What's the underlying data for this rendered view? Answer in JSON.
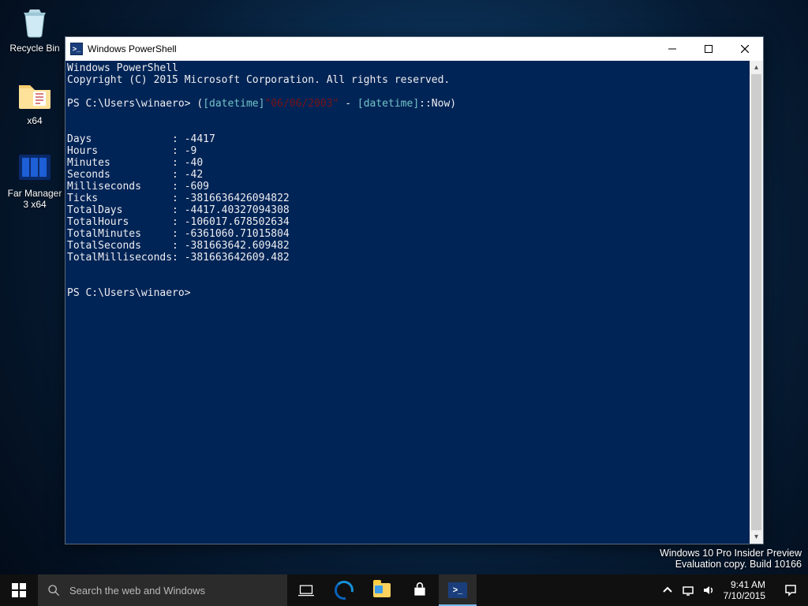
{
  "desktop": {
    "icons": [
      {
        "label": "Recycle Bin"
      },
      {
        "label": "x64"
      },
      {
        "label1": "Far Manager",
        "label2": "3 x64"
      }
    ]
  },
  "window": {
    "title": "Windows PowerShell",
    "console": {
      "header1": "Windows PowerShell",
      "header2": "Copyright (C) 2015 Microsoft Corporation. All rights reserved.",
      "prompt": "PS C:\\Users\\winaero> ",
      "cmd_open": "(",
      "cmd_type1": "[datetime]",
      "cmd_str": "\"06/06/2003\"",
      "cmd_mid": " - ",
      "cmd_type2": "[datetime]",
      "cmd_tail": "::Now)",
      "rows": [
        {
          "k": "Days",
          "v": "-4417"
        },
        {
          "k": "Hours",
          "v": "-9"
        },
        {
          "k": "Minutes",
          "v": "-40"
        },
        {
          "k": "Seconds",
          "v": "-42"
        },
        {
          "k": "Milliseconds",
          "v": "-609"
        },
        {
          "k": "Ticks",
          "v": "-3816636426094822"
        },
        {
          "k": "TotalDays",
          "v": "-4417.40327094308"
        },
        {
          "k": "TotalHours",
          "v": "-106017.678502634"
        },
        {
          "k": "TotalMinutes",
          "v": "-6361060.71015804"
        },
        {
          "k": "TotalSeconds",
          "v": "-381663642.609482"
        },
        {
          "k": "TotalMilliseconds",
          "v": "-381663642609.482"
        }
      ],
      "prompt2": "PS C:\\Users\\winaero> "
    }
  },
  "watermark": {
    "line1": "Windows 10 Pro Insider Preview",
    "line2": "Evaluation copy. Build 10166"
  },
  "taskbar": {
    "search_placeholder": "Search the web and Windows",
    "time": "9:41 AM",
    "date": "7/10/2015"
  }
}
